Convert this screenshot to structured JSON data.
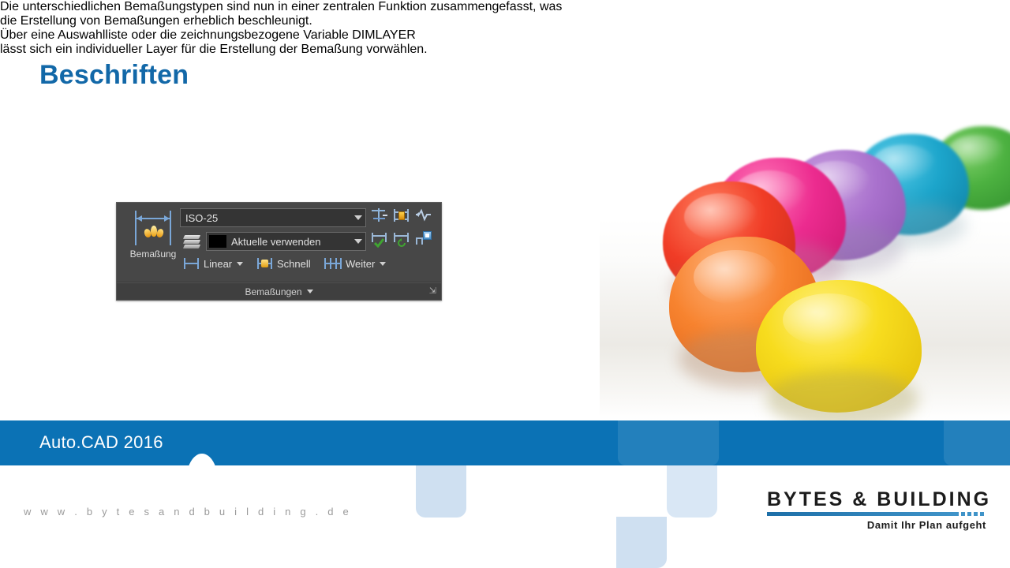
{
  "slide": {
    "title": "Beschriften",
    "paragraph_1_line_1": "Die unterschiedlichen Bemaßungstypen sind nun in einer zentralen Funktion zusammengefasst, was",
    "paragraph_1_line_2": "die Erstellung von Bemaßungen erheblich beschleunigt.",
    "paragraph_2_line_1": "Über eine Auswahlliste oder die zeichnungsbezogene Variable DIMLAYER",
    "paragraph_2_line_2": "lässt sich ein individueller Layer für die Erstellung der Bemaßung vorwählen."
  },
  "ribbon": {
    "big_button_label": "Bemaßung",
    "style_combo_value": "ISO-25",
    "layer_combo_value": "Aktuelle verwenden",
    "layer_swatch_color": "#000000",
    "buttons": [
      {
        "label": "Linear",
        "has_dropdown": true
      },
      {
        "label": "Schnell",
        "has_dropdown": false
      },
      {
        "label": "Weiter",
        "has_dropdown": true
      }
    ],
    "panel_title": "Bemaßungen",
    "dialog_launcher_glyph": "⇲",
    "icons": [
      "dimension-break-icon",
      "dimension-inspect-icon",
      "dimension-jogged-linear-icon",
      "dimension-continue-check-icon",
      "dimension-update-icon",
      "dimension-text-angle-icon"
    ]
  },
  "footer": {
    "bar_title": "Auto.CAD 2016",
    "website": "w w w . b y t e s a n d b u i l d i n g . d e",
    "logo_name": "BYTES & BUILDING",
    "logo_tagline": "Damit Ihr Plan aufgeht"
  },
  "colors": {
    "title_blue": "#1268a8",
    "bar_blue": "#0b72b5",
    "decor_light_blue": "#cfe0f1",
    "ribbon_bg": "#474747"
  },
  "photo": {
    "description": "colorful clay balls",
    "blobs": [
      {
        "name": "green",
        "color": "#3faa3a"
      },
      {
        "name": "cyan",
        "color": "#19a3c8"
      },
      {
        "name": "purple",
        "color": "#a770c9"
      },
      {
        "name": "pink",
        "color": "#e8248c"
      },
      {
        "name": "red",
        "color": "#ef3a2a"
      },
      {
        "name": "orange",
        "color": "#f4792a"
      },
      {
        "name": "yellow",
        "color": "#f5d616"
      }
    ]
  }
}
